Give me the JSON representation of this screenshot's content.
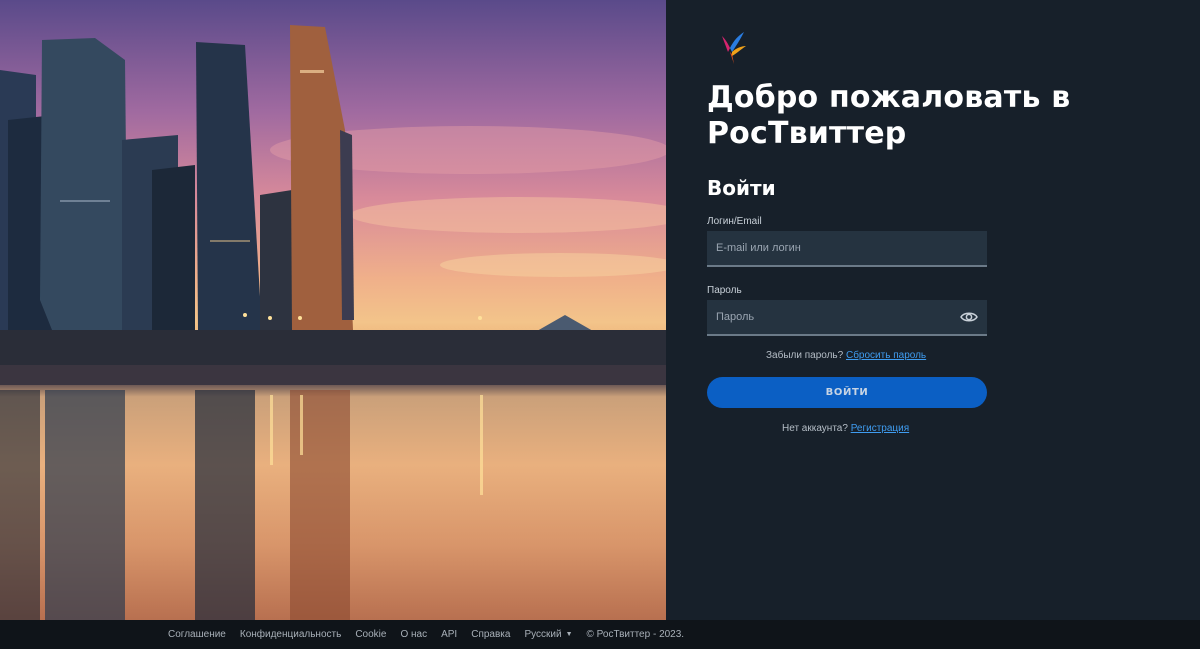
{
  "panel": {
    "headline": "Добро пожаловать в РосТвиттер",
    "login_title": "Войти",
    "login_label": "Логин/Email",
    "login_placeholder": "E-mail или логин",
    "password_label": "Пароль",
    "password_placeholder": "Пароль",
    "forgot_text": "Забыли пароль?",
    "forgot_link": "Сбросить пароль",
    "submit_label": "ВОЙТИ",
    "signup_text": "Нет аккаунта?",
    "signup_link": "Регистрация"
  },
  "footer": {
    "links": [
      "Соглашение",
      "Конфиденциальность",
      "Cookie",
      "О нас",
      "API",
      "Справка"
    ],
    "language": "Русский",
    "copyright": "© РосТвиттер - 2023."
  },
  "colors": {
    "panel_bg": "#17202a",
    "accent": "#0b5fc4",
    "link": "#3f9cf0"
  },
  "icons": [
    "bird-logo-icon",
    "eye-icon",
    "caret-down-icon"
  ]
}
